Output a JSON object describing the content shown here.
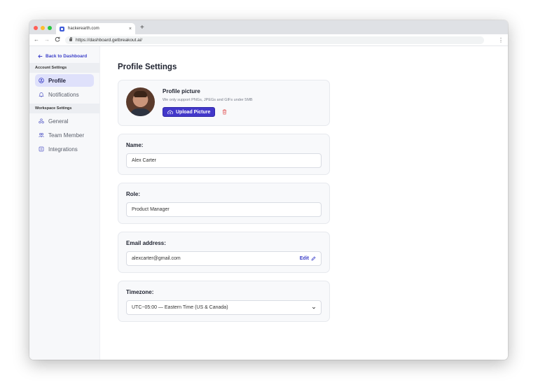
{
  "browser": {
    "tab_title": "hackerearth.com",
    "tab_close": "×",
    "new_tab": "+",
    "url": "https://dashboard.getbreakout.ai/",
    "back": "←",
    "forward": "→",
    "reload": "C",
    "menu": "⋮"
  },
  "sidebar": {
    "back_label": "Back to Dashboard",
    "account_section": "Account Settings",
    "account_items": [
      {
        "label": "Profile",
        "icon": "user-circle-icon",
        "active": true
      },
      {
        "label": "Notifications",
        "icon": "bell-icon",
        "active": false
      }
    ],
    "workspace_section": "Workspace Settings",
    "workspace_items": [
      {
        "label": "General",
        "icon": "cluster-icon"
      },
      {
        "label": "Team Member",
        "icon": "team-icon"
      },
      {
        "label": "Integrations",
        "icon": "integrations-icon"
      }
    ]
  },
  "main": {
    "title": "Profile Settings",
    "picture": {
      "title": "Profile picture",
      "subtitle": "We only support PNGs, JPEGs and GIFs under 5MB",
      "upload_label": "Upload Picture"
    },
    "name": {
      "label": "Name:",
      "value": "Alex Carter"
    },
    "role": {
      "label": "Role:",
      "value": "Product Manager"
    },
    "email": {
      "label": "Email address:",
      "value": "alexcarter@gmail.com",
      "edit_label": "Edit"
    },
    "timezone": {
      "label": "Timezone:",
      "value": "UTC−05:00 — Eastern Time (US & Canada)"
    }
  },
  "colors": {
    "accent": "#4338ca",
    "active_nav": "#dfe1fb",
    "danger": "#e25555"
  }
}
